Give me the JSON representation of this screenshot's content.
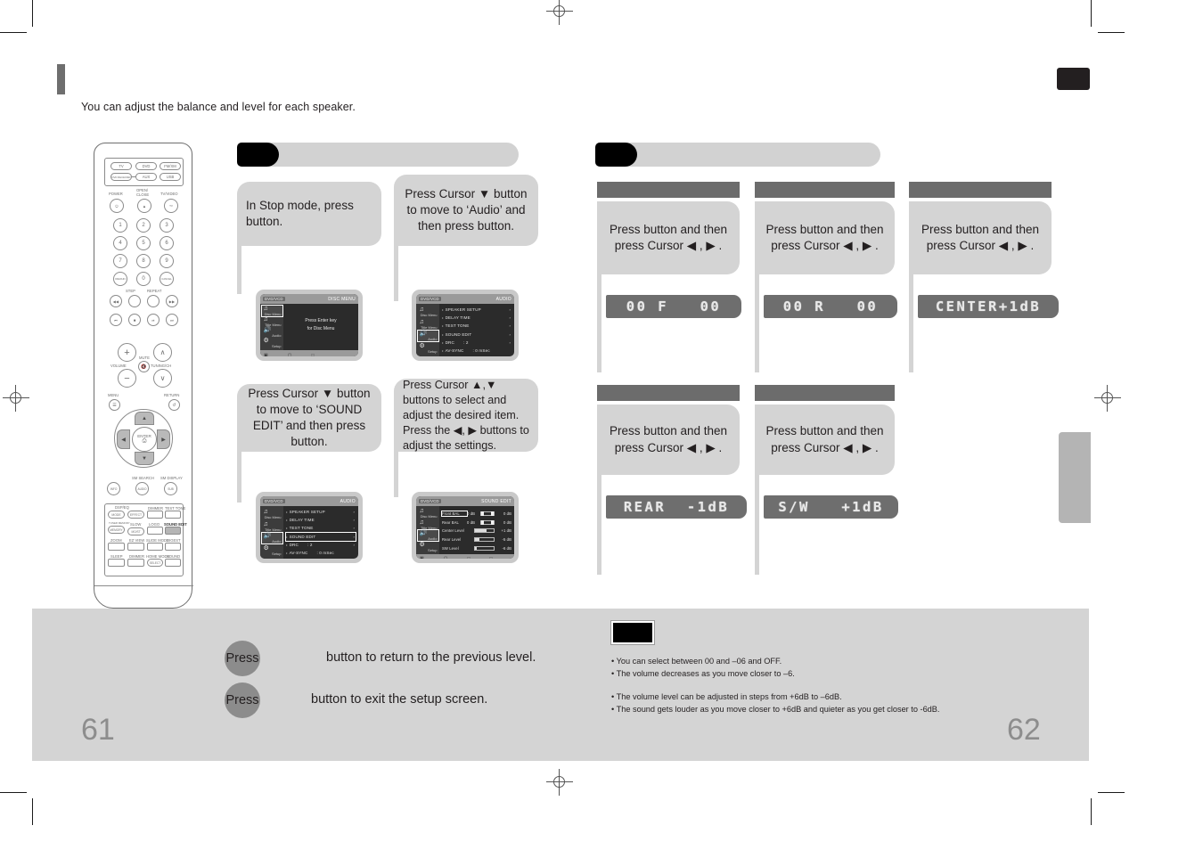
{
  "intro": "You can adjust the balance and level for each speaker.",
  "pages": {
    "left": "61",
    "right": "62"
  },
  "left_section": {
    "title": "",
    "steps": [
      {
        "id": "step1",
        "text": "In Stop mode, press\nbutton."
      },
      {
        "id": "step2",
        "text": "Press Cursor ▼ button to move to ‘Audio’ and then press button."
      },
      {
        "id": "step3",
        "text": "Press Cursor ▼ button to move to ‘SOUND EDIT’ and then press button."
      },
      {
        "id": "step4",
        "text": "Press Cursor ▲,▼ buttons to select and adjust the desired item. Press the ◀, ▶ buttons to adjust the settings."
      }
    ],
    "screens": {
      "screen1": {
        "topbar_left": "DVD/VCD",
        "topbar_right": "DISC MENU",
        "center_lines": [
          "Press Enter key",
          "for Disc Menu"
        ],
        "rail": [
          {
            "label": "Disc Menu",
            "icon": "disc-menu-icon",
            "selected": true
          },
          {
            "label": "Title Menu",
            "icon": "title-menu-icon",
            "selected": false
          },
          {
            "label": "Audio",
            "icon": "audio-icon",
            "selected": false
          },
          {
            "label": "Setup",
            "icon": "setup-icon",
            "selected": false
          }
        ]
      },
      "screen2": {
        "topbar_left": "DVD/VCD",
        "topbar_right": "AUDIO",
        "rail": [
          {
            "label": "Disc Menu",
            "icon": "disc-menu-icon",
            "selected": false
          },
          {
            "label": "Title Menu",
            "icon": "title-menu-icon",
            "selected": false
          },
          {
            "label": "Audio",
            "icon": "audio-icon",
            "selected": true
          },
          {
            "label": "Setup",
            "icon": "setup-icon",
            "selected": false
          }
        ],
        "menu": [
          {
            "name": "SPEAKER SETUP",
            "value": "",
            "arrow": true,
            "highlight": false
          },
          {
            "name": "DELAY TIME",
            "value": "",
            "arrow": true,
            "highlight": false
          },
          {
            "name": "TEST TONE",
            "value": "",
            "arrow": true,
            "highlight": false
          },
          {
            "name": "SOUND EDIT",
            "value": "",
            "arrow": true,
            "highlight": false
          },
          {
            "name": "DRC",
            "value": ": 2",
            "arrow": true,
            "highlight": false
          },
          {
            "name": "AV-SYNC",
            "value": ": 0 mSec",
            "arrow": false,
            "highlight": false
          }
        ]
      },
      "screen3": {
        "topbar_left": "DVD/VCD",
        "topbar_right": "AUDIO",
        "rail": [
          {
            "label": "Disc Menu",
            "icon": "disc-menu-icon",
            "selected": false
          },
          {
            "label": "Title Menu",
            "icon": "title-menu-icon",
            "selected": false
          },
          {
            "label": "Audio",
            "icon": "audio-icon",
            "selected": true
          },
          {
            "label": "Setup",
            "icon": "setup-icon",
            "selected": false
          }
        ],
        "menu": [
          {
            "name": "SPEAKER SETUP",
            "value": "",
            "arrow": true,
            "highlight": false
          },
          {
            "name": "DELAY TIME",
            "value": "",
            "arrow": true,
            "highlight": false
          },
          {
            "name": "TEST TONE",
            "value": "",
            "arrow": true,
            "highlight": false
          },
          {
            "name": "SOUND EDIT",
            "value": "",
            "arrow": true,
            "highlight": true
          },
          {
            "name": "DRC",
            "value": ": 2",
            "arrow": true,
            "highlight": false
          },
          {
            "name": "AV-SYNC",
            "value": ": 0 mSec",
            "arrow": false,
            "highlight": false
          }
        ]
      },
      "screen4": {
        "topbar_left": "DVD/VCD",
        "topbar_right": "SOUND EDIT",
        "rail": [
          {
            "label": "Disc Menu",
            "icon": "disc-menu-icon",
            "selected": false
          },
          {
            "label": "Title Menu",
            "icon": "title-menu-icon",
            "selected": false
          },
          {
            "label": "Audio",
            "icon": "audio-icon",
            "selected": true
          },
          {
            "label": "Setup",
            "icon": "setup-icon",
            "selected": false
          }
        ],
        "rows": [
          {
            "name": "Front BAL",
            "mid": "0 dB",
            "value": "0 dB",
            "fill": 0,
            "knob": 0,
            "highlight": true
          },
          {
            "name": "Rear BAL",
            "mid": "0 dB",
            "value": "0 dB",
            "fill": 0,
            "knob": 18,
            "highlight": false
          },
          {
            "name": "Center Level",
            "mid": "",
            "value": "+1 dB",
            "fill": 62,
            "knob": -1,
            "highlight": false
          },
          {
            "name": "Rear Level",
            "mid": "",
            "value": "-5 dB",
            "fill": 22,
            "knob": -1,
            "highlight": false
          },
          {
            "name": "SW Level",
            "mid": "",
            "value": "-6 dB",
            "fill": 10,
            "knob": -1,
            "highlight": false
          }
        ]
      }
    }
  },
  "right_section": {
    "title": "",
    "cards": [
      {
        "id": "card-front",
        "text": "Press         button and then press Cursor ◀ , ▶ .",
        "vfd": "00 F   00"
      },
      {
        "id": "card-rear-bal",
        "text": "Press         button and then press Cursor ◀ , ▶ .",
        "vfd": "00 R   00"
      },
      {
        "id": "card-center",
        "text": "Press         button and then press Cursor ◀ , ▶ .",
        "vfd": "CENTER+1dB"
      },
      {
        "id": "card-rear-level",
        "text": "Press         button and then press Cursor ◀ , ▶ .",
        "vfd": "REAR  -1dB"
      },
      {
        "id": "card-sw-level",
        "text": "Press         button and then press Cursor ◀ , ▶ .",
        "vfd": "S/W   +1dB"
      }
    ]
  },
  "footer": {
    "press_rows": [
      {
        "circle": "Press",
        "tail": "button to return to the previous level."
      },
      {
        "circle": "Press",
        "tail": "button to exit the setup screen."
      }
    ],
    "notes_group_a": [
      "• You can select between 00 and –06 and OFF.",
      "• The volume decreases as you move closer to –6."
    ],
    "notes_group_b": [
      "• The volume level can be adjusted in steps from +6dB to –6dB.",
      "• The sound gets louder as you move closer to +6dB and quieter as you get closer to -6dB."
    ]
  },
  "remote": {
    "source_buttons": [
      "TV",
      "DVD",
      "FM/XM",
      "DVD RECEIVER",
      "AUX",
      "USB"
    ],
    "top_labels": [
      "POWER",
      "OPEN/ CLOSE",
      "TV/VIDEO"
    ],
    "numbers": [
      "1",
      "2",
      "3",
      "4",
      "5",
      "6",
      "7",
      "8",
      "9",
      "REMAIN",
      "0",
      "CANCEL"
    ],
    "transport_labels": [
      "STEP",
      "REPEAT"
    ],
    "volume_labels": [
      "VOLUME",
      "MUTE",
      "TUNING/CH"
    ],
    "nav_labels": [
      "MENU",
      "RETURN",
      "ENTER"
    ],
    "mid_labels": [
      "INFO",
      "SM SEARCH",
      "AUDIO",
      "SM DISPLAY",
      "SUBTITLE"
    ],
    "function_buttons": [
      {
        "label": "MODE",
        "caption": "DSP/EQ"
      },
      {
        "label": "EFFECT",
        "caption": ""
      },
      {
        "label": "",
        "caption": "DIMMER"
      },
      {
        "label": "",
        "caption": "TEST TONE"
      },
      {
        "label": "MEMORY",
        "caption": "TUNER MEMORY"
      },
      {
        "label": "MO/ST",
        "caption": "SLOW"
      },
      {
        "label": "",
        "caption": "LOGO"
      },
      {
        "label": "",
        "caption": "SOUND EDIT",
        "highlight": true
      },
      {
        "label": "",
        "caption": "ZOOM"
      },
      {
        "label": "",
        "caption": "EZ VIEW"
      },
      {
        "label": "",
        "caption": "SLIDE MODE"
      },
      {
        "label": "",
        "caption": "DIGEST"
      },
      {
        "label": "",
        "caption": "SLEEP"
      },
      {
        "label": "",
        "caption": "DIMMER"
      },
      {
        "label": "SELECT",
        "caption": "HOME MODE"
      },
      {
        "label": "",
        "caption": "SOUND"
      }
    ]
  }
}
